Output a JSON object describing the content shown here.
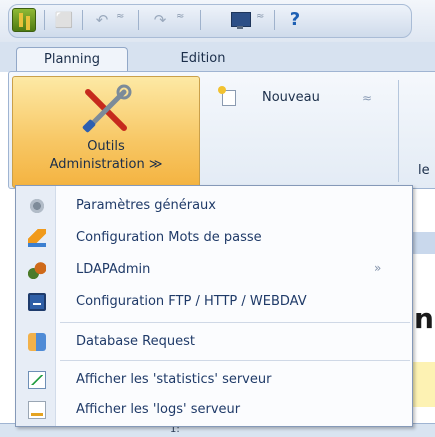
{
  "toolbar": {
    "items": [
      "app-icon",
      "toolbar-button-disabled",
      "undo-icon",
      "redo-icon",
      "monitor-icon",
      "help-icon"
    ],
    "help_label": "?"
  },
  "tabs": [
    {
      "label": "Planning",
      "active": true
    },
    {
      "label": "Edition",
      "active": false
    }
  ],
  "ribbon": {
    "outils_line1": "Outils",
    "outils_line2": "Administration ≫",
    "nouveau_label": "Nouveau",
    "right_partial": "le"
  },
  "menu": {
    "items": [
      {
        "label": "Paramètres généraux",
        "icon": "gear-icon"
      },
      {
        "label": "Configuration Mots de passe",
        "icon": "flask-icon"
      },
      {
        "label": "LDAPAdmin",
        "icon": "ldap-icon",
        "submenu": "»"
      },
      {
        "label": "Configuration FTP / HTTP / WEBDAV",
        "icon": "ftp-icon"
      },
      {
        "label": "Database Request",
        "icon": "database-icon"
      },
      {
        "label": "Afficher les 'statistics' serveur",
        "icon": "statistics-icon"
      },
      {
        "label": "Afficher les 'logs' serveur",
        "icon": "logs-icon"
      }
    ]
  },
  "background": {
    "partial_heading": "n",
    "footer_text": "1:"
  },
  "colors": {
    "ribbon_active": "#f7c663",
    "menu_text": "#1f3a68",
    "tab_bg": "#d7e2f0"
  }
}
